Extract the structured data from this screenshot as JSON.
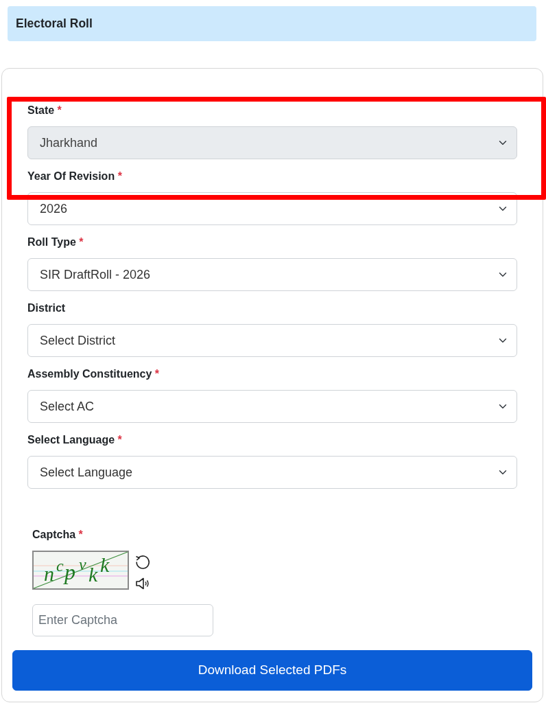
{
  "header": {
    "title": "Electoral Roll"
  },
  "form": {
    "fields": [
      {
        "label": "State",
        "marker": "*",
        "value": "Jharkhand",
        "disabled": true,
        "highlighted": true
      },
      {
        "label": "Year Of Revision",
        "marker": "*",
        "value": "2026",
        "disabled": false,
        "highlighted": false
      },
      {
        "label": "Roll Type",
        "marker": "*",
        "value": "SIR DraftRoll - 2026",
        "disabled": false,
        "highlighted": false
      },
      {
        "label": "District",
        "value": "Select District",
        "disabled": false,
        "highlighted": false
      },
      {
        "label": "Assembly Constituency",
        "marker": "*",
        "value": "Select AC",
        "disabled": false,
        "highlighted": false
      },
      {
        "label": "Select Language",
        "marker": "*",
        "value": "Select Language",
        "disabled": false,
        "highlighted": false
      }
    ]
  },
  "captcha": {
    "label": "Captcha",
    "marker": "*",
    "image_text": "ncpvkk",
    "placeholder": "Enter Captcha"
  },
  "button": {
    "label": "Download Selected PDFs"
  }
}
